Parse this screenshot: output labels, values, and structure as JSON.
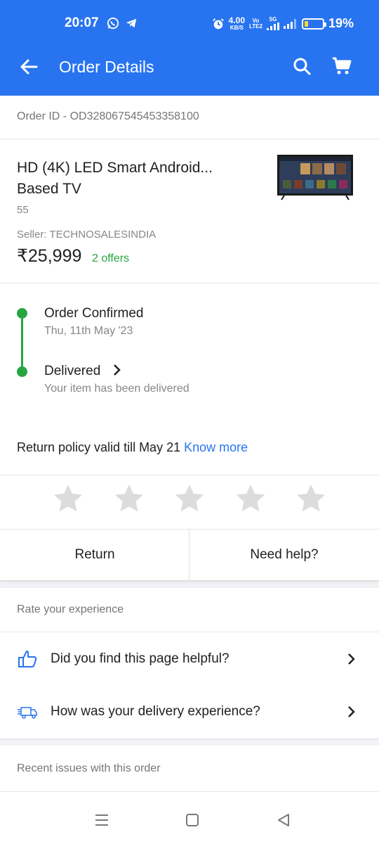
{
  "status_bar": {
    "time": "20:07",
    "net_speed_value": "4.00",
    "net_speed_unit": "KB/S",
    "volte_top": "Vo",
    "volte_bottom": "LTE2",
    "network": "5G",
    "battery_percent": "19%",
    "battery_level": 0.19,
    "left_icons": [
      "whatsapp-icon",
      "telegram-icon"
    ],
    "right_icons": [
      "alarm-icon",
      "signal-icon",
      "signal-icon-2",
      "battery-icon"
    ]
  },
  "app_bar": {
    "title": "Order Details",
    "icons": [
      "back-arrow-icon",
      "search-icon",
      "cart-icon"
    ],
    "color": "#2874f0"
  },
  "order": {
    "id_text": "Order ID - OD328067545453358100"
  },
  "product": {
    "name": "HD (4K) LED Smart Android... Based TV",
    "variant": "55",
    "seller": "Seller: TECHNOSALESINDIA",
    "price": "₹25,999",
    "offers": "2 offers"
  },
  "tracking": {
    "steps": [
      {
        "title": "Order Confirmed",
        "subtitle": "Thu, 11th May '23"
      },
      {
        "title": "Delivered",
        "subtitle": "Your item has been delivered"
      }
    ],
    "accent": "#26a541"
  },
  "return_policy": {
    "text": "Return policy valid till May 21",
    "link": "Know more"
  },
  "rating": {
    "stars_total": 5,
    "stars_filled": 0
  },
  "actions": {
    "return_label": "Return",
    "help_label": "Need help?"
  },
  "rate_experience": {
    "header": "Rate your experience",
    "items": [
      {
        "label": "Did you find this page helpful?",
        "icon": "thumbs-up-icon"
      },
      {
        "label": "How was your delivery experience?",
        "icon": "delivery-truck-icon"
      }
    ]
  },
  "recent_issues": {
    "label": "Recent issues with this order"
  },
  "nav_bar": {
    "icons": [
      "menu-icon",
      "home-icon",
      "back-icon"
    ]
  }
}
